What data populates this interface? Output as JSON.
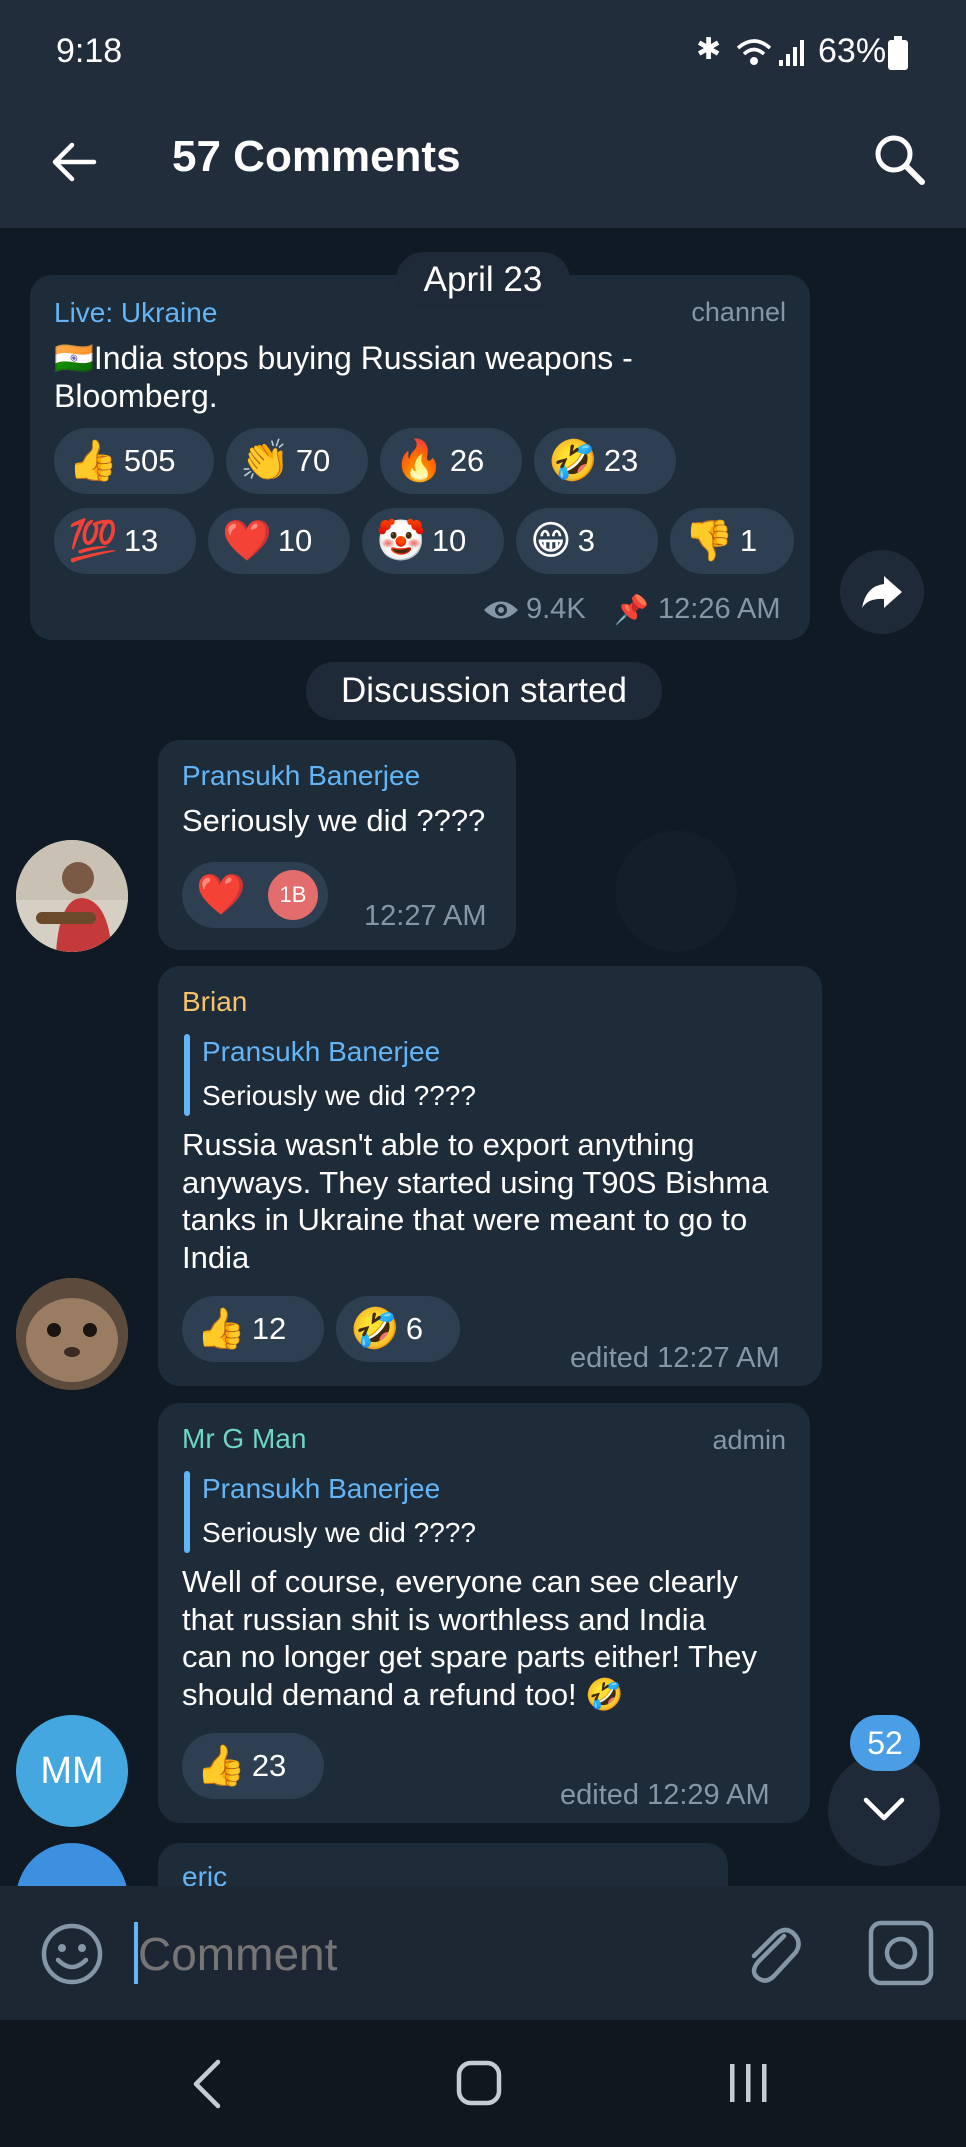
{
  "status": {
    "time": "9:18",
    "battery": "63%"
  },
  "header": {
    "title": "57 Comments"
  },
  "date_pill": "April 23",
  "channel_post": {
    "channel": "Live: Ukraine",
    "tag": "channel",
    "text_line1": "🇮🇳India stops buying Russian weapons -",
    "text_line2": "Bloomberg.",
    "reactions": [
      {
        "emoji": "👍",
        "count": "505"
      },
      {
        "emoji": "👏",
        "count": "70"
      },
      {
        "emoji": "🔥",
        "count": "26"
      },
      {
        "emoji": "🤣",
        "count": "23"
      },
      {
        "emoji": "💯",
        "count": "13"
      },
      {
        "emoji": "❤️",
        "count": "10"
      },
      {
        "emoji": "🤡",
        "count": "10"
      },
      {
        "emoji": "😁",
        "count": "3"
      },
      {
        "emoji": "👎",
        "count": "1"
      }
    ],
    "views": "9.4K",
    "time": "12:26 AM"
  },
  "discussion_pill": "Discussion started",
  "messages": [
    {
      "author": "Pransukh Banerjee",
      "text": "Seriously we did ????",
      "reaction_emoji": "❤️",
      "reactor_initials": "1B",
      "time": "12:27 AM"
    },
    {
      "author": "Brian",
      "quote_author": "Pransukh Banerjee",
      "quote_text": "Seriously we did ????",
      "lines": [
        "Russia wasn't able to export anything",
        "anyways. They started using T90S Bishma",
        "tanks in Ukraine that were meant to go to",
        "India"
      ],
      "reactions": [
        {
          "emoji": "👍",
          "count": "12"
        },
        {
          "emoji": "🤣",
          "count": "6"
        }
      ],
      "time": "edited 12:27 AM"
    },
    {
      "author": "Mr G Man",
      "role": "admin",
      "avatar_initials": "MM",
      "quote_author": "Pransukh Banerjee",
      "quote_text": "Seriously we did ????",
      "lines": [
        "Well of course, everyone can see clearly",
        "that russian shit is worthless and India",
        "can no longer get spare parts either! They",
        "should demand a refund too! 🤣"
      ],
      "reactions": [
        {
          "emoji": "👍",
          "count": "23"
        }
      ],
      "time": "edited 12:29 AM"
    },
    {
      "author": "eric"
    }
  ],
  "unread_badge": "52",
  "input": {
    "placeholder": "Comment"
  },
  "colors": {
    "accent": "#64b5f6",
    "brian": "#f5c26b",
    "mrgman": "#6fd6c4",
    "admin_avatar": "#45a7e0"
  }
}
